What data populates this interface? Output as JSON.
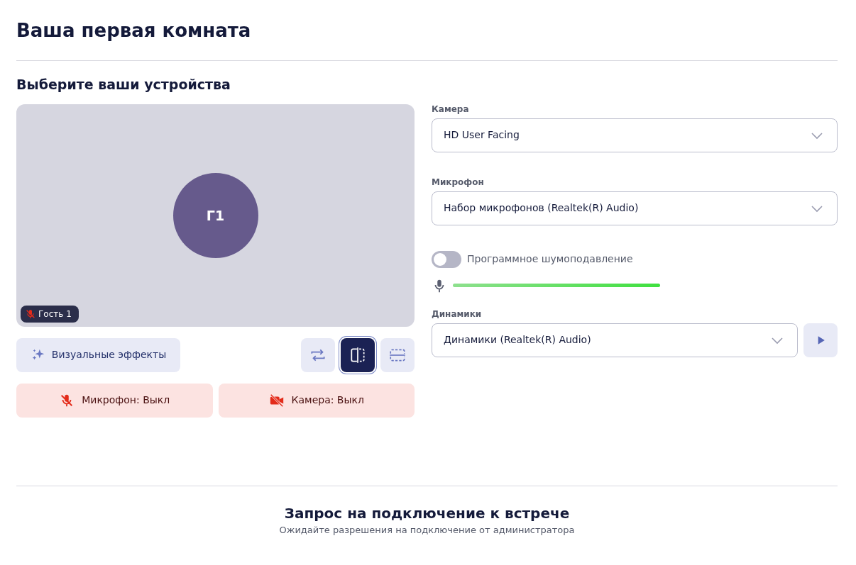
{
  "title": "Ваша первая комната",
  "devices_heading": "Выберите ваши устройства",
  "preview": {
    "avatar_initials": "Г1",
    "participant": {
      "name": "Гость 1",
      "muted": true
    }
  },
  "effects_button": "Визуальные эффекты",
  "view_modes": [
    {
      "kind": "swap",
      "selected": false
    },
    {
      "kind": "mirror",
      "selected": true
    },
    {
      "kind": "crop",
      "selected": false
    }
  ],
  "toggles": [
    {
      "kind": "mic",
      "label": "Микрофон: Выкл",
      "on": false
    },
    {
      "kind": "camera",
      "label": "Камера: Выкл",
      "on": false
    }
  ],
  "camera": {
    "label": "Камера",
    "value": "HD User Facing"
  },
  "microphone": {
    "label": "Микрофон",
    "value": "Набор микрофонов (Realtek(R) Audio)"
  },
  "noise_suppression": {
    "label": "Программное шумоподавление",
    "on": false
  },
  "mic_meter": {
    "level": 0.73
  },
  "speakers": {
    "label": "Динамики",
    "value": "Динамики (Realtek(R) Audio)"
  },
  "footer": {
    "heading": "Запрос на подключение к встрече",
    "text": "Ожидайте разрешения на подключение от администратора"
  }
}
